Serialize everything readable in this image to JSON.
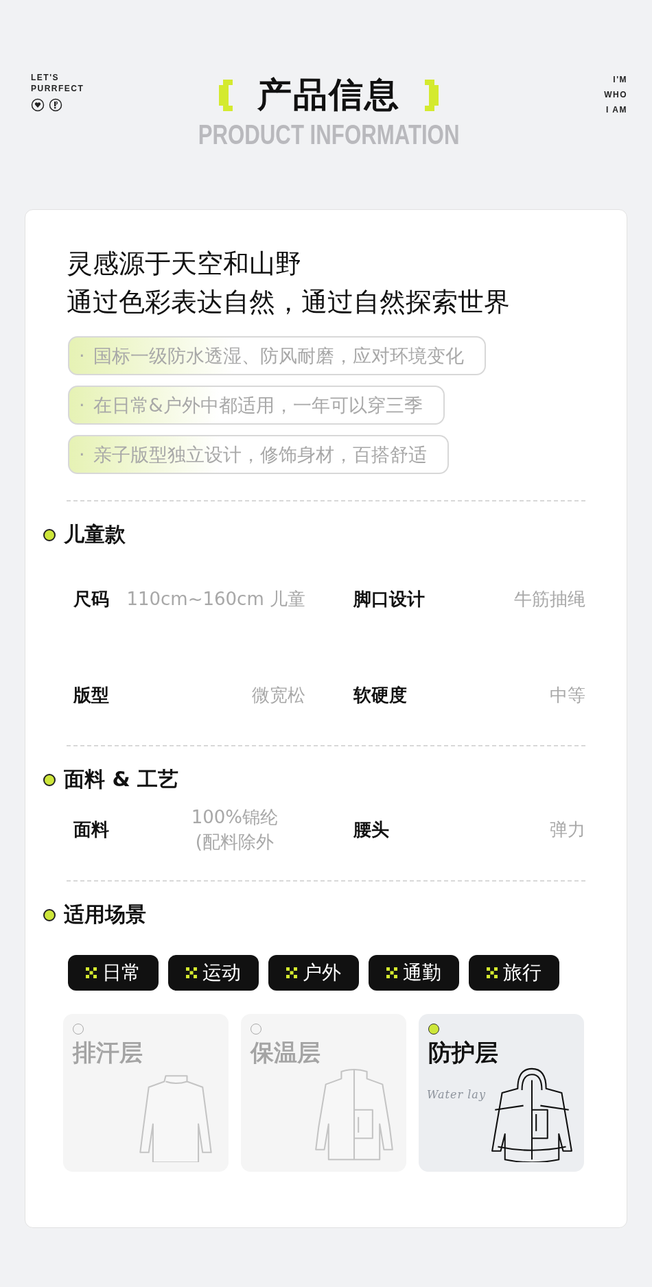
{
  "header": {
    "brand_lines": [
      "LET'S",
      "PURRFECT"
    ],
    "title": "产品信息",
    "subtitle": "PRODUCT INFORMATION",
    "motto_lines": [
      "I'M",
      "WHO",
      "I AM"
    ]
  },
  "headline": [
    "灵感源于天空和山野",
    "通过色彩表达自然，通过自然探索世界"
  ],
  "features": [
    {
      "bullet": "·",
      "text": "国标一级防水透湿、防风耐磨，应对环境变化"
    },
    {
      "bullet": "·",
      "text": "在日常&户外中都适用，一年可以穿三季"
    },
    {
      "bullet": "·",
      "text": "亲子版型独立设计，修饰身材，百搭舒适"
    }
  ],
  "sections": [
    {
      "title": "儿童款",
      "specs": [
        {
          "label": "尺码",
          "value": [
            "110cm~160cm 儿童"
          ]
        },
        {
          "label": "脚口设计",
          "value": [
            "牛筋抽绳"
          ]
        },
        {
          "label": "版型",
          "value": [
            "微宽松"
          ]
        },
        {
          "label": "软硬度",
          "value": [
            "中等"
          ]
        }
      ]
    },
    {
      "title": "面料 & 工艺",
      "specs": [
        {
          "label": "面料",
          "value": [
            "100%锦纶",
            "(配料除外"
          ]
        },
        {
          "label": "腰头",
          "value": [
            "弹力"
          ]
        }
      ]
    }
  ],
  "scenes": {
    "title": "适用场景",
    "tags": [
      "日常",
      "运动",
      "户外",
      "通勤",
      "旅行"
    ]
  },
  "layers": [
    {
      "kind": "sweater",
      "name": "排汗层",
      "selected": false
    },
    {
      "kind": "fleece",
      "name": "保温层",
      "selected": false
    },
    {
      "kind": "shell",
      "name": "防护层",
      "selected": true,
      "script": "Water lay"
    }
  ]
}
